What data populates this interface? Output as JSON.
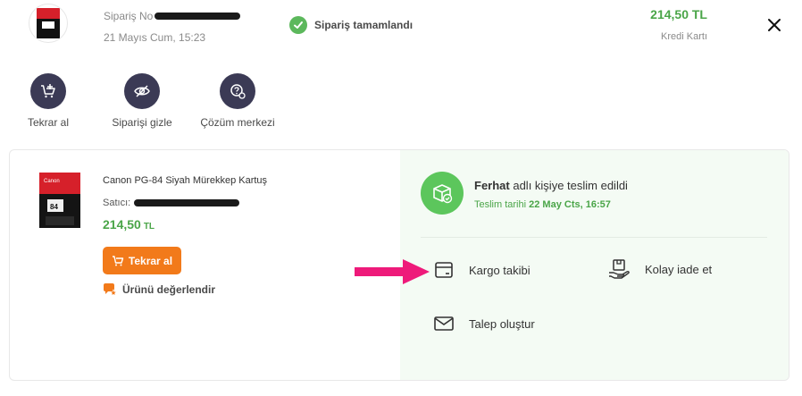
{
  "header": {
    "order_no_label": "Sipariş No",
    "order_date": "21 Mayıs Cum, 15:23",
    "status_text": "Sipariş tamamlandı",
    "price": "214,50 TL",
    "payment_method": "Kredi Kartı"
  },
  "actions": [
    {
      "label": "Tekrar al",
      "icon": "cart-plus-icon"
    },
    {
      "label": "Siparişi gizle",
      "icon": "eye-off-icon"
    },
    {
      "label": "Çözüm merkezi",
      "icon": "help-center-icon"
    }
  ],
  "product": {
    "name": "Canon PG-84 Siyah Mürekkep Kartuş",
    "seller_label": "Satıcı:",
    "price_value": "214,50",
    "price_currency": "TL",
    "reorder_label": "Tekrar al",
    "rate_label": "Ürünü değerlendir"
  },
  "delivery": {
    "recipient_name": "Ferhat",
    "delivered_text": " adlı kişiye teslim edildi",
    "date_label": "Teslim tarihi ",
    "date_value": "22 May Cts, 16:57",
    "links": {
      "tracking": "Kargo takibi",
      "easy_return": "Kolay iade et",
      "create_request": "Talep oluştur"
    }
  },
  "colors": {
    "accent_green": "#4aa548",
    "status_green": "#5cb85c",
    "orange_button": "#f27a1a",
    "icon_circle": "#3b3a55",
    "arrow_pink": "#ee1a7a"
  }
}
